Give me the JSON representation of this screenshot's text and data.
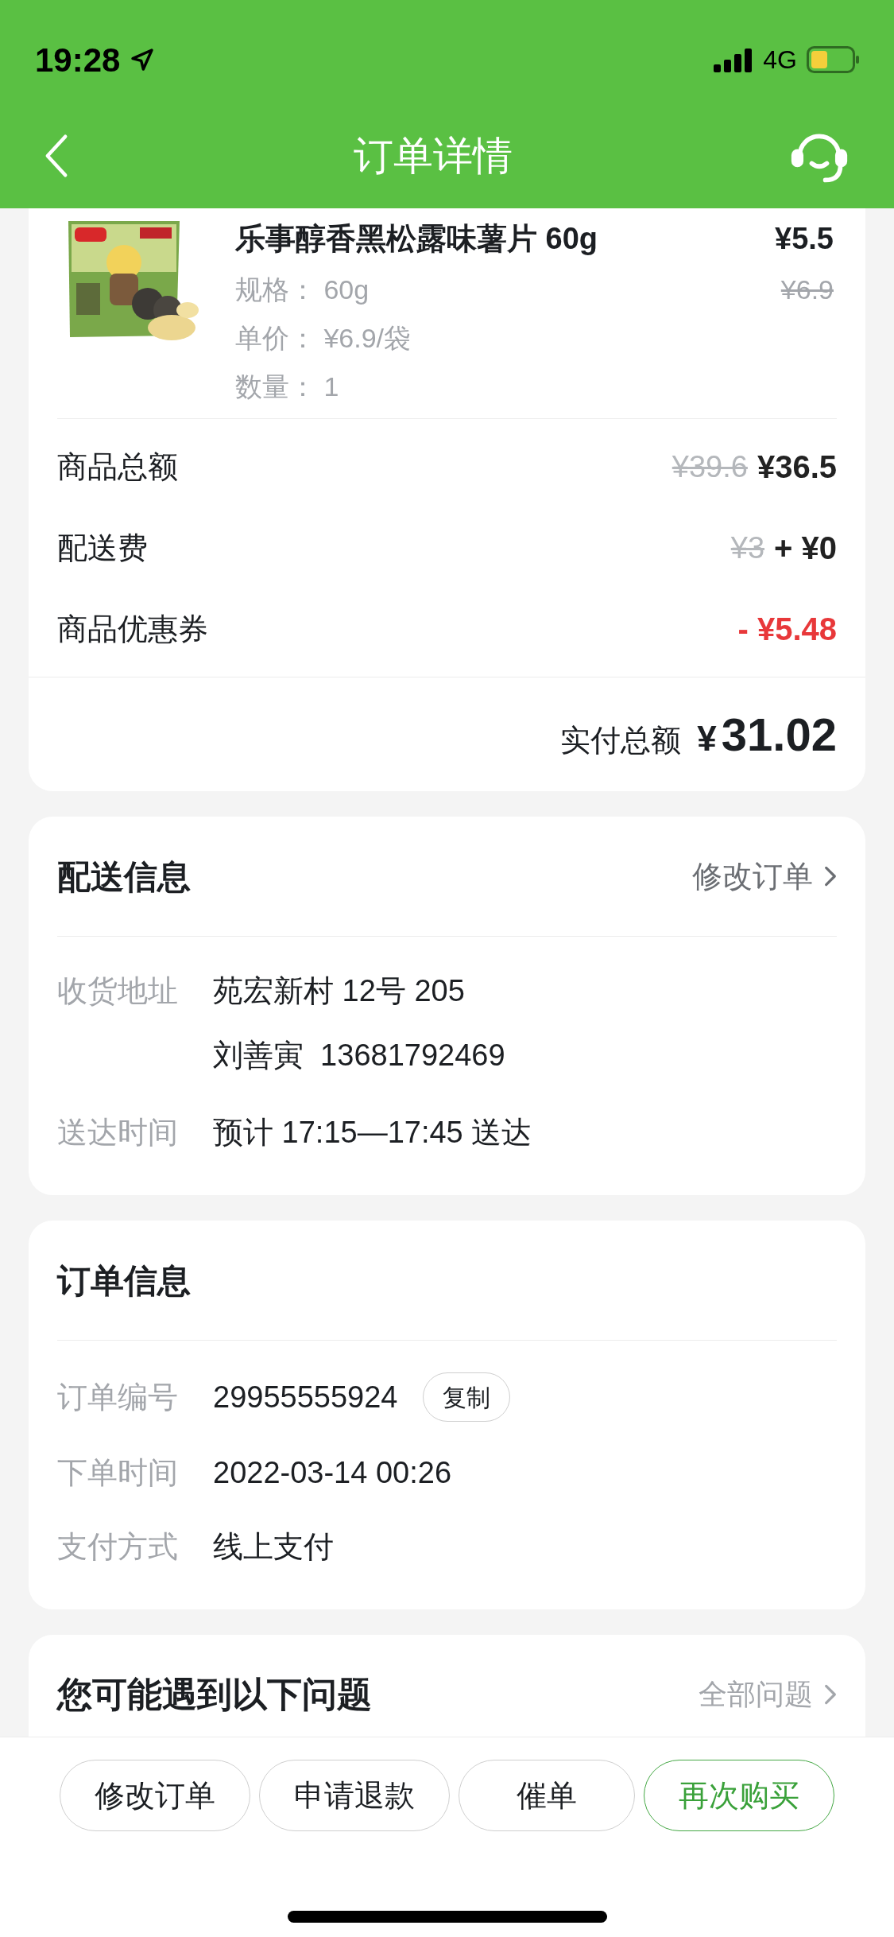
{
  "status_bar": {
    "time": "19:28",
    "network": "4G"
  },
  "header": {
    "title": "订单详情"
  },
  "product": {
    "name": "乐事醇香黑松露味薯片 60g",
    "price": "¥5.5",
    "original_price": "¥6.9",
    "specs": [
      {
        "label": "规格：",
        "value": "60g"
      },
      {
        "label": "单价：",
        "value": "¥6.9/袋"
      },
      {
        "label": "数量：",
        "value": "1"
      }
    ]
  },
  "summary": [
    {
      "label": "商品总额",
      "original": "¥39.6",
      "value": "¥36.5",
      "kind": "normal"
    },
    {
      "label": "配送费",
      "original": "¥3",
      "value": "+ ¥0",
      "kind": "normal"
    },
    {
      "label": "商品优惠券",
      "value": "- ¥5.48",
      "kind": "discount"
    }
  ],
  "total": {
    "label": "实付总额",
    "currency": "¥",
    "amount": "31.02"
  },
  "delivery": {
    "title": "配送信息",
    "action": "修改订单",
    "rows": [
      {
        "label": "收货地址",
        "lines": [
          "苑宏新村 12号 205",
          "刘善寅  13681792469"
        ]
      },
      {
        "label": "送达时间",
        "lines": [
          "预计 17:15—17:45 送达"
        ]
      }
    ]
  },
  "order_info": {
    "title": "订单信息",
    "rows": [
      {
        "label": "订单编号",
        "value": "29955555924",
        "button": "复制"
      },
      {
        "label": "下单时间",
        "value": "2022-03-14 00:26"
      },
      {
        "label": "支付方式",
        "value": "线上支付"
      }
    ]
  },
  "faq": {
    "title": "您可能遇到以下问题",
    "action": "全部问题"
  },
  "buttons": [
    {
      "label": "修改订单",
      "kind": "default"
    },
    {
      "label": "申请退款",
      "kind": "default"
    },
    {
      "label": "催单",
      "kind": "default"
    },
    {
      "label": "再次购买",
      "kind": "primary"
    }
  ]
}
